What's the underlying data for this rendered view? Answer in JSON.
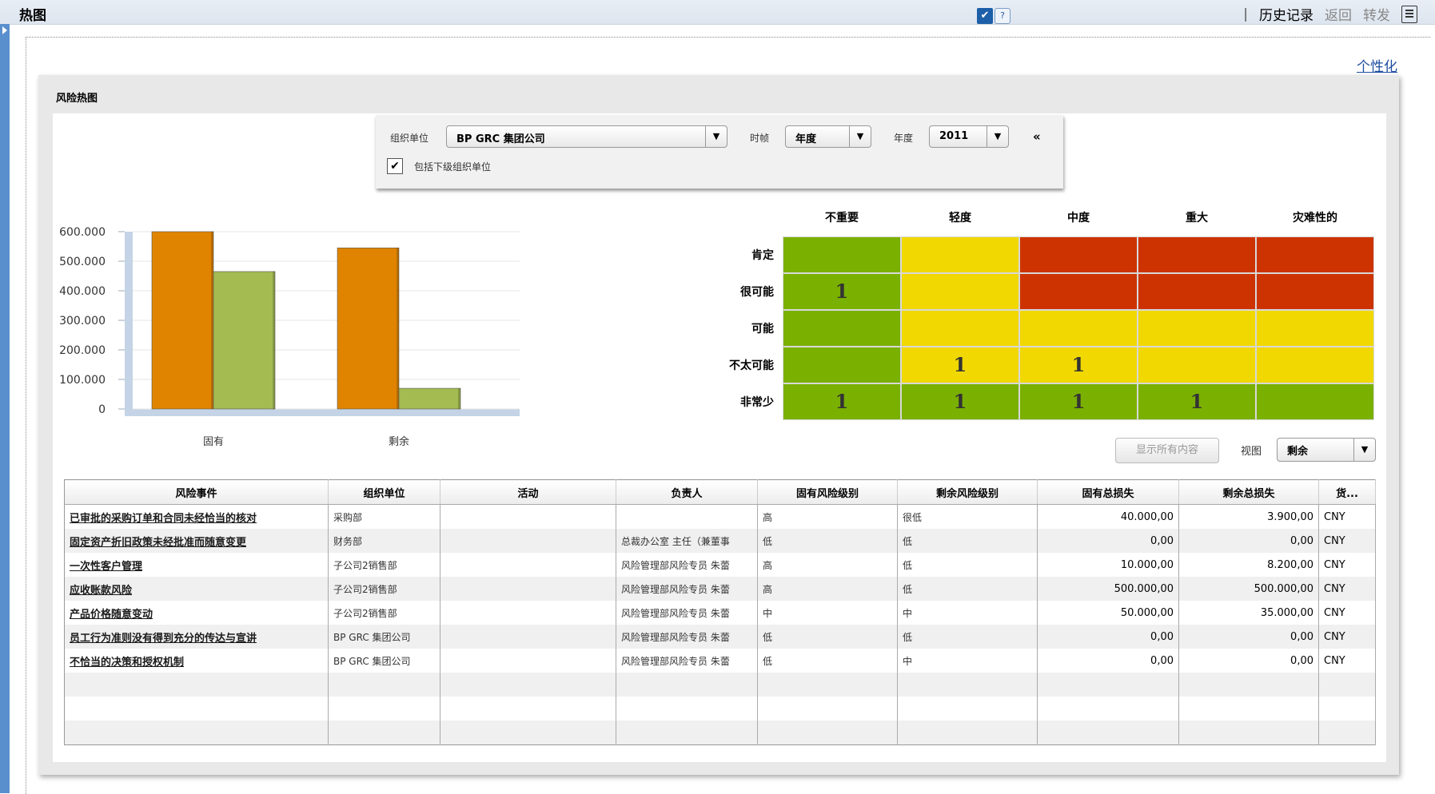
{
  "titlebar": {
    "title": "热图",
    "history": "历史记录",
    "back": "返回",
    "forward": "转发",
    "help": "?"
  },
  "personalize": "个性化",
  "panel": {
    "title": "风险热图"
  },
  "filter": {
    "org_label": "组织单位",
    "org_value": "BP GRC 集团公司",
    "timeframe_label": "时帧",
    "timeframe_value": "年度",
    "year_label": "年度",
    "year_value": "2011",
    "include_sub_label": "包括下级组织单位",
    "include_sub_checked": true,
    "collapse": "«"
  },
  "chart_data": {
    "type": "bar",
    "categories": [
      "固有",
      "剩余"
    ],
    "series": [
      {
        "values": [
          600000,
          545000
        ],
        "color": "#e08400"
      },
      {
        "values": [
          465000,
          70000
        ],
        "color": "#a4bb52"
      }
    ],
    "yticks": [
      "600.000",
      "500.000",
      "400.000",
      "300.000",
      "200.000",
      "100.000",
      "0"
    ],
    "ylim": [
      0,
      600000
    ],
    "grid": true
  },
  "heatmap": {
    "columns": [
      "不重要",
      "轻度",
      "中度",
      "重大",
      "灾难性的"
    ],
    "rows": [
      "肯定",
      "很可能",
      "可能",
      "不太可能",
      "非常少"
    ],
    "colors": [
      [
        "#7ab000",
        "#f0d800",
        "#cc3300",
        "#cc3300",
        "#cc3300"
      ],
      [
        "#7ab000",
        "#f0d800",
        "#cc3300",
        "#cc3300",
        "#cc3300"
      ],
      [
        "#7ab000",
        "#f0d800",
        "#f0d800",
        "#f0d800",
        "#f0d800"
      ],
      [
        "#7ab000",
        "#f0d800",
        "#f0d800",
        "#f0d800",
        "#f0d800"
      ],
      [
        "#7ab000",
        "#7ab000",
        "#7ab000",
        "#7ab000",
        "#7ab000"
      ]
    ],
    "values": [
      [
        "",
        "",
        "",
        "",
        ""
      ],
      [
        "1",
        "",
        "",
        "",
        ""
      ],
      [
        "",
        "",
        "",
        "",
        ""
      ],
      [
        "",
        "1",
        "1",
        "",
        ""
      ],
      [
        "1",
        "1",
        "1",
        "1",
        ""
      ]
    ]
  },
  "controls": {
    "show_all": "显示所有内容",
    "view_label": "视图",
    "view_value": "剩余"
  },
  "table": {
    "headers": [
      "风险事件",
      "组织单位",
      "活动",
      "负责人",
      "固有风险级别",
      "剩余风险级别",
      "固有总损失",
      "剩余总损失",
      "货..."
    ],
    "rows": [
      [
        "已审批的采购订单和合同未经恰当的核对",
        "采购部",
        "",
        "",
        "高",
        "很低",
        "40.000,00",
        "3.900,00",
        "CNY"
      ],
      [
        "固定资产折旧政策未经批准而随意变更",
        "财务部",
        "",
        "总裁办公室 主任（兼董事",
        "低",
        "低",
        "0,00",
        "0,00",
        "CNY"
      ],
      [
        "一次性客户管理",
        "子公司2销售部",
        "",
        "风险管理部风险专员 朱蕾",
        "高",
        "低",
        "10.000,00",
        "8.200,00",
        "CNY"
      ],
      [
        "应收账款风险",
        "子公司2销售部",
        "",
        "风险管理部风险专员 朱蕾",
        "高",
        "低",
        "500.000,00",
        "500.000,00",
        "CNY"
      ],
      [
        "产品价格随意变动",
        "子公司2销售部",
        "",
        "风险管理部风险专员 朱蕾",
        "中",
        "中",
        "50.000,00",
        "35.000,00",
        "CNY"
      ],
      [
        "员工行为准则没有得到充分的传达与宣讲",
        "BP GRC 集团公司",
        "",
        "风险管理部风险专员 朱蕾",
        "低",
        "低",
        "0,00",
        "0,00",
        "CNY"
      ],
      [
        "不恰当的决策和授权机制",
        "BP GRC 集团公司",
        "",
        "风险管理部风险专员 朱蕾",
        "低",
        "中",
        "0,00",
        "0,00",
        "CNY"
      ],
      [
        "",
        "",
        "",
        "",
        "",
        "",
        "",
        "",
        ""
      ],
      [
        "",
        "",
        "",
        "",
        "",
        "",
        "",
        "",
        ""
      ],
      [
        "",
        "",
        "",
        "",
        "",
        "",
        "",
        "",
        ""
      ]
    ]
  }
}
